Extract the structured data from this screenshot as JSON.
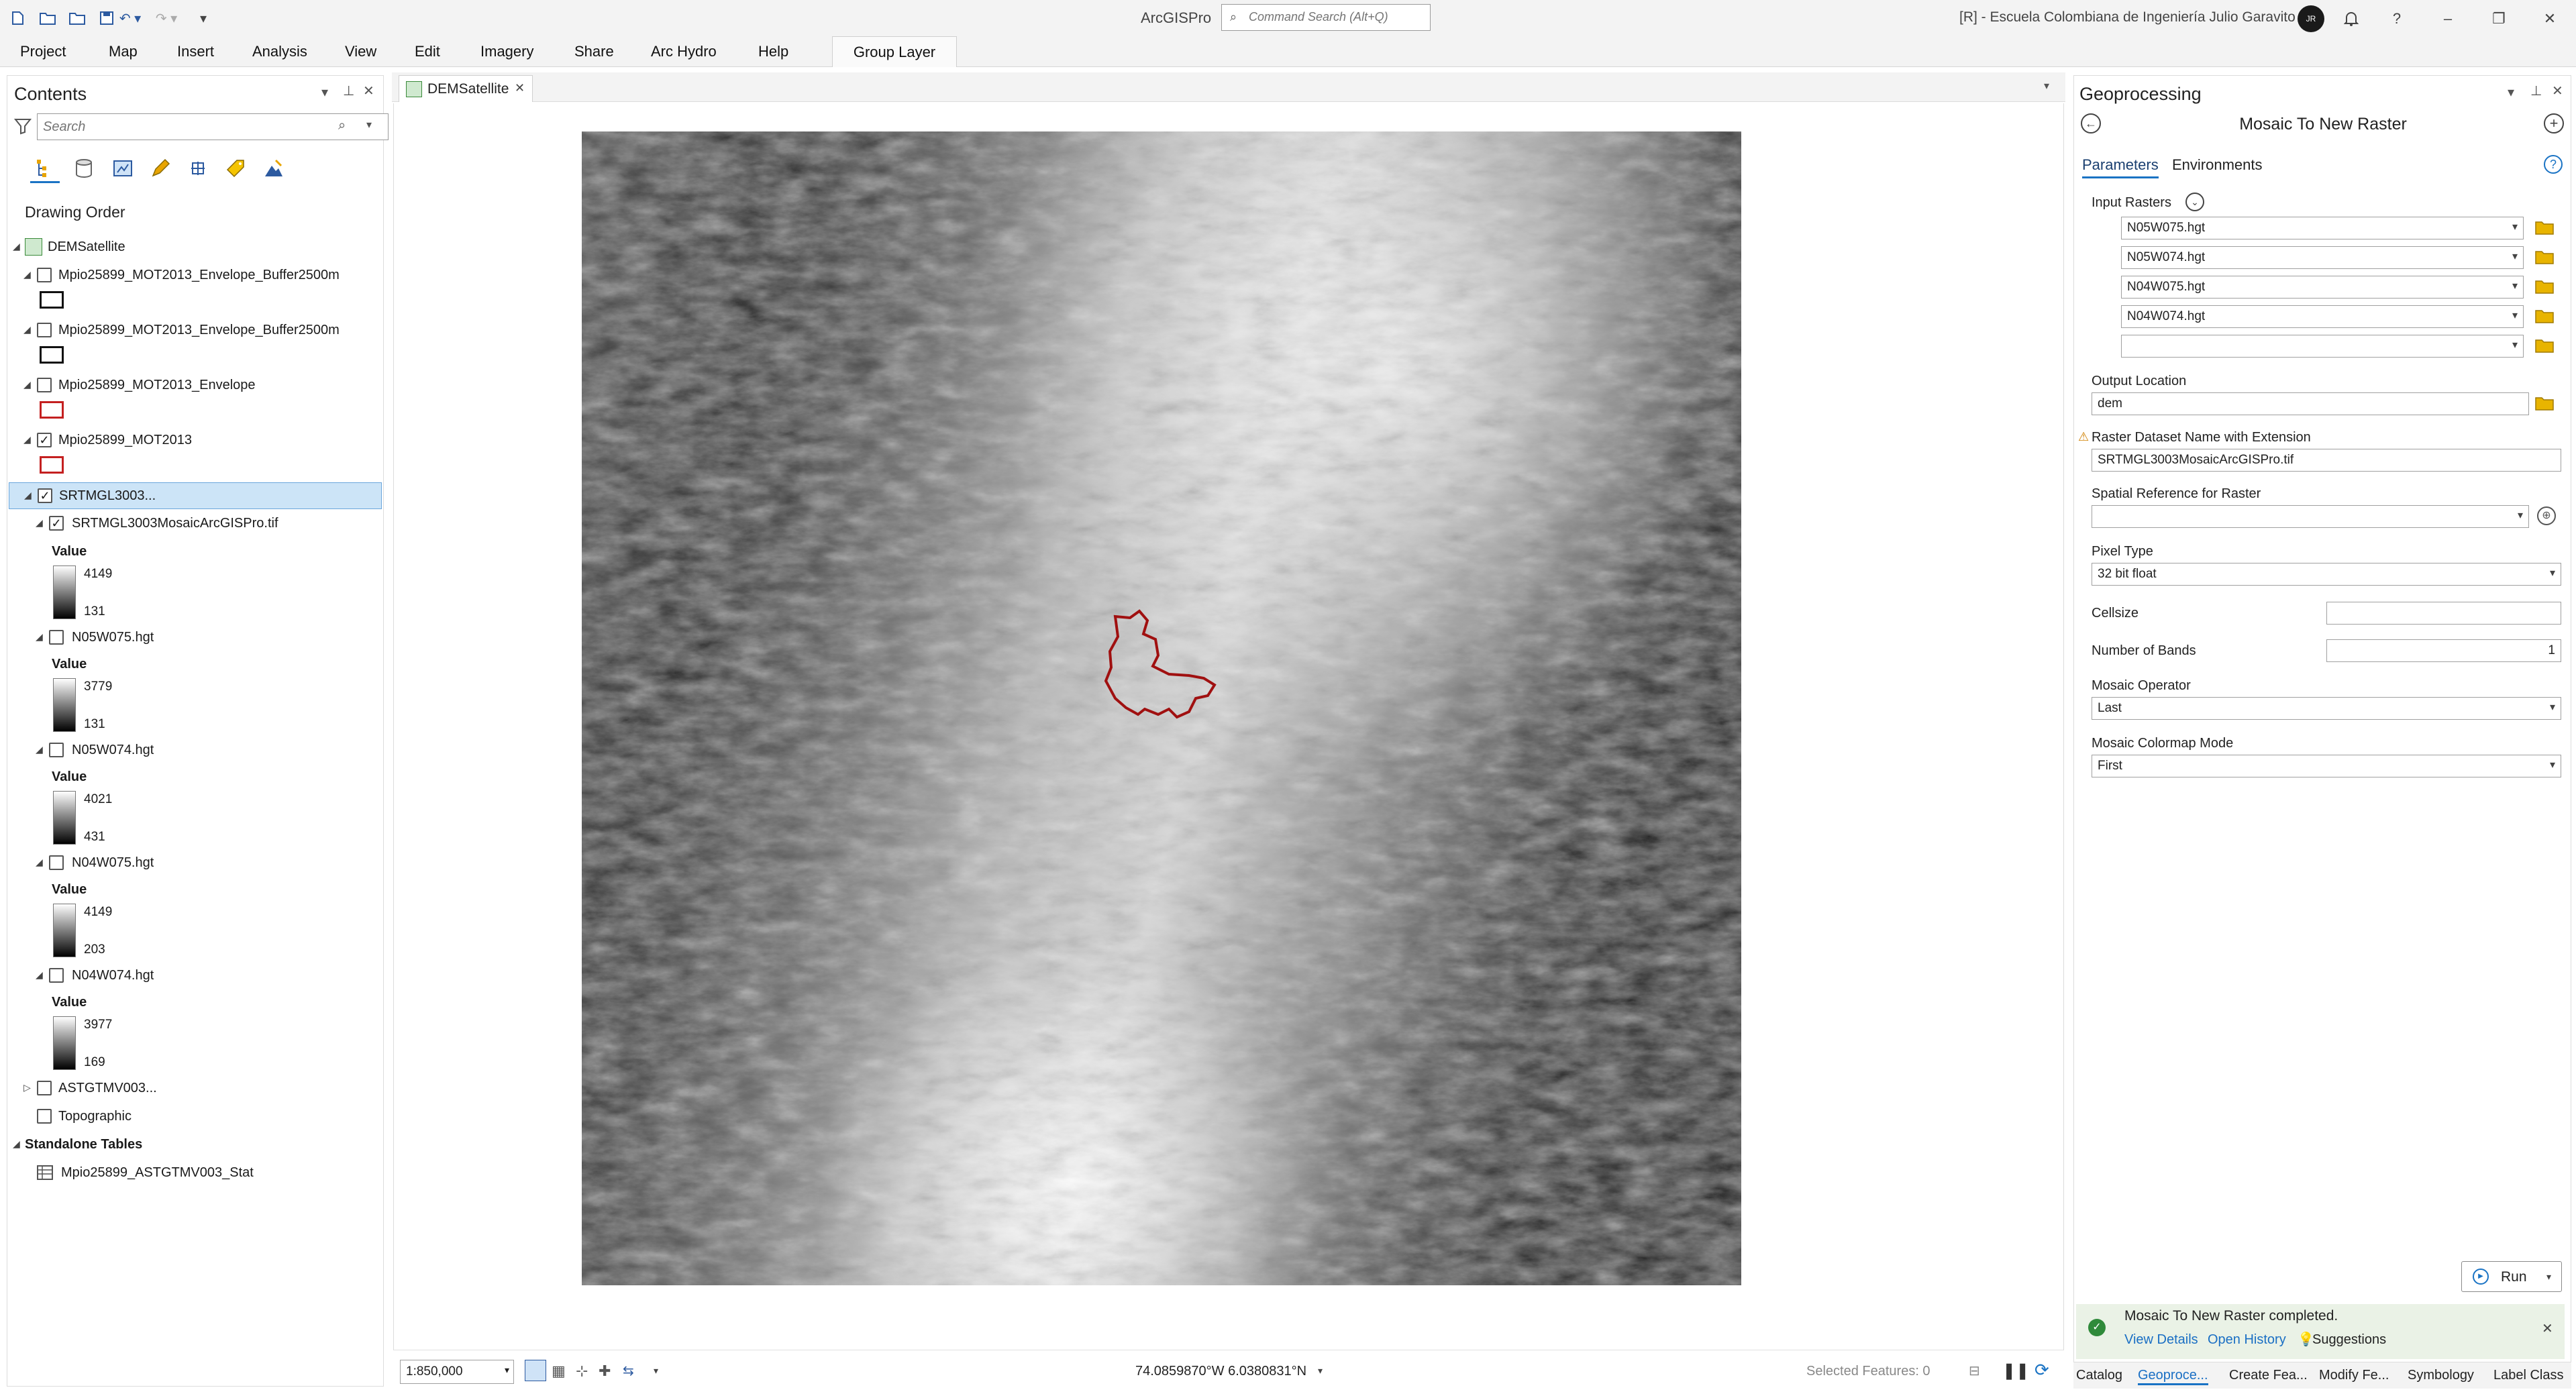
{
  "titlebar": {
    "app_title": "ArcGISPro",
    "command_search_placeholder": "Command Search (Alt+Q)",
    "org_label": "[R] - Escuela Colombiana de Ingeniería Julio Garavito",
    "avatar_initials": "JR"
  },
  "ribbon": {
    "tabs": [
      "Project",
      "Map",
      "Insert",
      "Analysis",
      "View",
      "Edit",
      "Imagery",
      "Share",
      "Arc Hydro",
      "Help"
    ],
    "contextual_tab": "Group Layer"
  },
  "contents": {
    "title": "Contents",
    "search_placeholder": "Search",
    "drawing_order_label": "Drawing Order",
    "map_name": "DEMSatellite",
    "layers": [
      {
        "name": "Mpio25899_MOT2013_Envelope_Buffer2500m",
        "checked": false,
        "symbol": "black-outline"
      },
      {
        "name": "Mpio25899_MOT2013_Envelope_Buffer2500m",
        "checked": false,
        "symbol": "black-outline"
      },
      {
        "name": "Mpio25899_MOT2013_Envelope",
        "checked": false,
        "symbol": "red-outline"
      },
      {
        "name": "Mpio25899_MOT2013",
        "checked": true,
        "symbol": "red-outline"
      }
    ],
    "group_layer": {
      "name": "SRTMGL3003...",
      "checked": true
    },
    "rasters": [
      {
        "name": "SRTMGL3003MosaicArcGISPro.tif",
        "checked": true,
        "value_label": "Value",
        "max": "4149",
        "min": "131"
      },
      {
        "name": "N05W075.hgt",
        "checked": false,
        "value_label": "Value",
        "max": "3779",
        "min": "131"
      },
      {
        "name": "N05W074.hgt",
        "checked": false,
        "value_label": "Value",
        "max": "4021",
        "min": "431"
      },
      {
        "name": "N04W075.hgt",
        "checked": false,
        "value_label": "Value",
        "max": "4149",
        "min": "203"
      },
      {
        "name": "N04W074.hgt",
        "checked": false,
        "value_label": "Value",
        "max": "3977",
        "min": "169"
      }
    ],
    "other_layers": [
      {
        "name": "ASTGTMV003...",
        "checked": false
      },
      {
        "name": "Topographic",
        "checked": false
      }
    ],
    "standalone_tables_label": "Standalone Tables",
    "standalone_table": "Mpio25899_ASTGTMV003_Stat"
  },
  "map": {
    "tab_label": "DEMSatellite",
    "scale": "1:850,000",
    "coordinates": "74.0859870°W 6.0380831°N",
    "selected_features": "Selected Features: 0"
  },
  "geoprocessing": {
    "title": "Geoprocessing",
    "tool_title": "Mosaic To New Raster",
    "tabs": {
      "parameters": "Parameters",
      "environments": "Environments"
    },
    "input_rasters_label": "Input Rasters",
    "input_rasters": [
      "N05W075.hgt",
      "N05W074.hgt",
      "N04W075.hgt",
      "N04W074.hgt",
      ""
    ],
    "output_location_label": "Output Location",
    "output_location": "dem",
    "raster_name_label": "Raster Dataset Name with Extension",
    "raster_name": "SRTMGL3003MosaicArcGISPro.tif",
    "spatial_ref_label": "Spatial Reference for  Raster",
    "spatial_ref": "",
    "pixel_type_label": "Pixel Type",
    "pixel_type": "32 bit float",
    "cellsize_label": "Cellsize",
    "cellsize": "",
    "bands_label": "Number of Bands",
    "bands": "1",
    "mosaic_operator_label": "Mosaic Operator",
    "mosaic_operator": "Last",
    "colormap_label": "Mosaic Colormap Mode",
    "colormap": "First",
    "run_label": "Run",
    "notification": {
      "message": "Mosaic To New Raster completed.",
      "view_details": "View Details",
      "open_history": "Open History",
      "suggestions": "Suggestions"
    },
    "bottom_tabs": [
      "Catalog",
      "Geoproce...",
      "Create Fea...",
      "Modify Fe...",
      "Symbology",
      "Label Class"
    ]
  }
}
